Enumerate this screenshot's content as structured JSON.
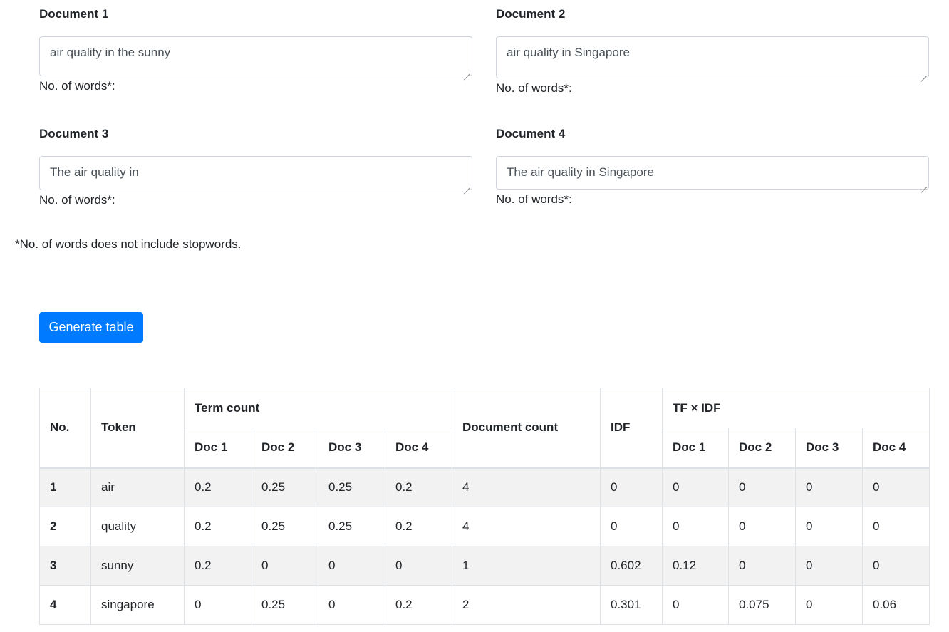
{
  "documents": [
    {
      "title": "Document 1",
      "text": "air quality in the sunny",
      "word_count_label": "No. of words*:"
    },
    {
      "title": "Document 2",
      "text": "air quality in Singapore",
      "word_count_label": "No. of words*:"
    },
    {
      "title": "Document 3",
      "text": "The air quality in",
      "word_count_label": "No. of words*:"
    },
    {
      "title": "Document 4",
      "text": "The air quality in Singapore",
      "word_count_label": "No. of words*:"
    }
  ],
  "note": "*No. of words does not include stopwords.",
  "generate_button_label": "Generate table",
  "table": {
    "headers": {
      "no": "No.",
      "token": "Token",
      "term_count": "Term count",
      "document_count": "Document count",
      "idf": "IDF",
      "tfidf": "TF × IDF",
      "docs": [
        "Doc 1",
        "Doc 2",
        "Doc 3",
        "Doc 4"
      ]
    },
    "rows": [
      {
        "no": "1",
        "token": "air",
        "tc": [
          "0.2",
          "0.25",
          "0.25",
          "0.2"
        ],
        "doc_count": "4",
        "idf": "0",
        "tfidf": [
          "0",
          "0",
          "0",
          "0"
        ]
      },
      {
        "no": "2",
        "token": "quality",
        "tc": [
          "0.2",
          "0.25",
          "0.25",
          "0.2"
        ],
        "doc_count": "4",
        "idf": "0",
        "tfidf": [
          "0",
          "0",
          "0",
          "0"
        ]
      },
      {
        "no": "3",
        "token": "sunny",
        "tc": [
          "0.2",
          "0",
          "0",
          "0"
        ],
        "doc_count": "1",
        "idf": "0.602",
        "tfidf": [
          "0.12",
          "0",
          "0",
          "0"
        ]
      },
      {
        "no": "4",
        "token": "singapore",
        "tc": [
          "0",
          "0.25",
          "0",
          "0.2"
        ],
        "doc_count": "2",
        "idf": "0.301",
        "tfidf": [
          "0",
          "0.075",
          "0",
          "0.06"
        ]
      }
    ]
  },
  "colors": {
    "primary": "#007bff",
    "stripe": "#f2f2f2",
    "border": "#dee2e6"
  }
}
